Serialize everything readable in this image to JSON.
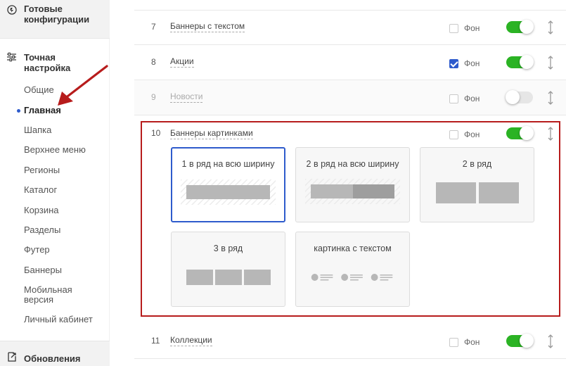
{
  "sidebar": {
    "ready_configs": "Готовые конфигурации",
    "fine_tuning": "Точная настройка",
    "items": [
      {
        "label": "Общие"
      },
      {
        "label": "Главная"
      },
      {
        "label": "Шапка"
      },
      {
        "label": "Верхнее меню"
      },
      {
        "label": "Регионы"
      },
      {
        "label": "Каталог"
      },
      {
        "label": "Корзина"
      },
      {
        "label": "Разделы"
      },
      {
        "label": "Футер"
      },
      {
        "label": "Баннеры"
      },
      {
        "label": "Мобильная версия"
      },
      {
        "label": "Личный кабинет"
      }
    ],
    "active_item": "Главная",
    "updates": "Обновления"
  },
  "colors": {
    "accent": "#2e5bcc",
    "toggle_on": "#2bb324",
    "highlight": "#b71c1c"
  },
  "blocks": [
    {
      "num": "7",
      "name": "Баннеры с текстом",
      "bg_label": "Фон",
      "bg_checked": false,
      "enabled": true
    },
    {
      "num": "8",
      "name": "Акции",
      "bg_label": "Фон",
      "bg_checked": true,
      "enabled": true
    },
    {
      "num": "9",
      "name": "Новости",
      "bg_label": "Фон",
      "bg_checked": false,
      "enabled": false
    },
    {
      "num": "10",
      "name": "Баннеры картинками",
      "bg_label": "Фон",
      "bg_checked": false,
      "enabled": true
    },
    {
      "num": "11",
      "name": "Коллекции",
      "bg_label": "Фон",
      "bg_checked": false,
      "enabled": true
    }
  ],
  "layout_options": [
    {
      "label": "1 в ряд на всю ширину",
      "selected": true
    },
    {
      "label": "2 в ряд на всю ширину",
      "selected": false
    },
    {
      "label": "2 в ряд",
      "selected": false
    },
    {
      "label": "3 в ряд",
      "selected": false
    },
    {
      "label": "картинка с текстом",
      "selected": false
    }
  ]
}
